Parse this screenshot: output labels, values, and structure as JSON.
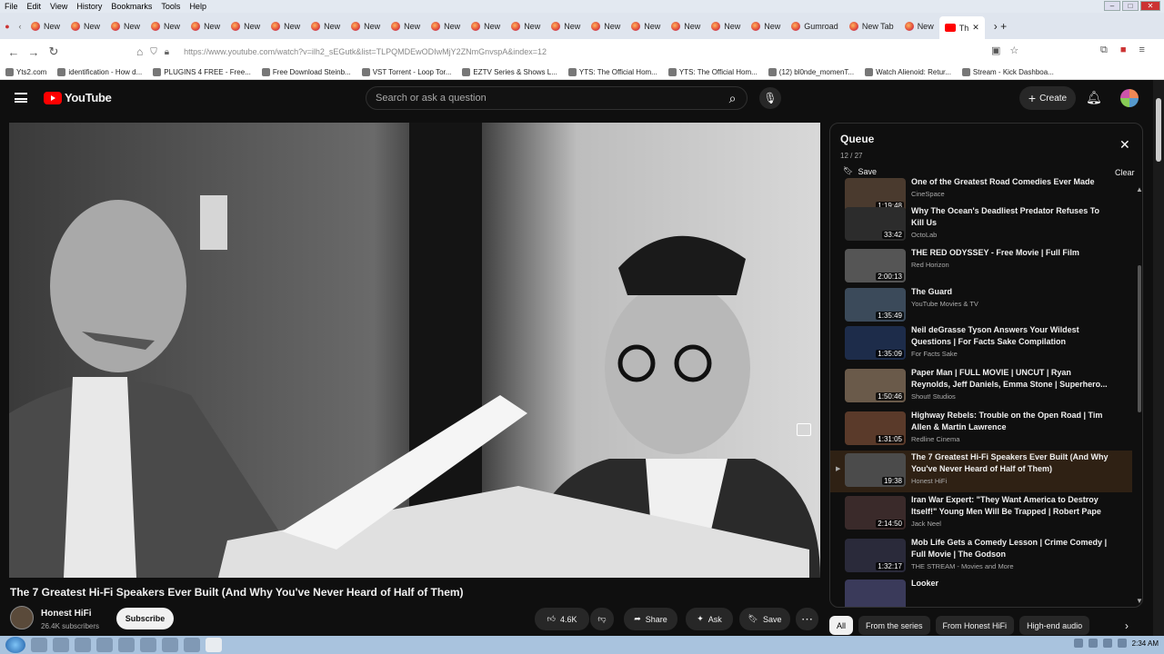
{
  "browser": {
    "menu": [
      "File",
      "Edit",
      "View",
      "History",
      "Bookmarks",
      "Tools",
      "Help"
    ],
    "tabs": [
      "New",
      "New",
      "New",
      "New",
      "New",
      "New",
      "New",
      "New",
      "New",
      "New",
      "New",
      "New",
      "New",
      "New",
      "New",
      "New",
      "New",
      "New",
      "New",
      "Gumroad",
      "New Tab",
      "New"
    ],
    "active_tab_label": "Th",
    "url": "https://www.youtube.com/watch?v=ilh2_sEGutk&list=TLPQMDEwODIwMjY2ZNmGnvspA&index=12",
    "bookmarks": [
      "Yts2.com",
      "identification - How d...",
      "PLUGINS 4 FREE - Free...",
      "Free Download Steinb...",
      "VST Torrent - Loop Tor...",
      "EZTV Series & Shows L...",
      "YTS: The Official Hom...",
      "YTS: The Official Hom...",
      "(12) bl0nde_momenT...",
      "Watch Alienoid: Retur...",
      "Stream - Kick Dashboa..."
    ],
    "colors": {
      "accent": "#ff0000",
      "dark_bg": "#0f0f0f"
    }
  },
  "youtube": {
    "logo_text": "YouTube",
    "search_placeholder": "Search or ask a question",
    "create_label": "Create"
  },
  "video": {
    "title": "The 7 Greatest Hi-Fi Speakers Ever Built (And Why You've Never Heard of Half of Them)",
    "channel": "Honest HiFi",
    "subscribers": "26.4K subscribers",
    "subscribe_label": "Subscribe",
    "likes": "4.6K",
    "share_label": "Share",
    "ask_label": "Ask",
    "save_label": "Save"
  },
  "queue": {
    "title": "Queue",
    "position": "12 / 27",
    "save_label": "Save",
    "clear_label": "Clear",
    "items": [
      {
        "title": "One of the Greatest Road Comedies Ever Made",
        "channel": "CineSpace",
        "duration": "1:19:48",
        "thumb": "#4a3a2e"
      },
      {
        "title": "Why The Ocean's Deadliest Predator Refuses To Kill Us",
        "channel": "OctoLab",
        "duration": "33:42",
        "thumb": "#2c2c2c"
      },
      {
        "title": "THE RED ODYSSEY - Free Movie | Full Film",
        "channel": "Red Horizon",
        "duration": "2:00:13",
        "thumb": "#555555"
      },
      {
        "title": "The Guard",
        "channel": "YouTube Movies & TV",
        "duration": "1:35:49",
        "thumb": "#3b4a5a"
      },
      {
        "title": "Neil deGrasse Tyson Answers Your Wildest Questions | For Facts Sake Compilation",
        "channel": "For Facts Sake",
        "duration": "1:35:09",
        "thumb": "#1d2c4a"
      },
      {
        "title": "Paper Man | FULL MOVIE | UNCUT | Ryan Reynolds, Jeff Daniels, Emma Stone | Superhero...",
        "channel": "Shout! Studios",
        "duration": "1:50:46",
        "thumb": "#6a5a4a"
      },
      {
        "title": "Highway Rebels: Trouble on the Open Road | Tim Allen & Martin Lawrence",
        "channel": "Redline Cinema",
        "duration": "1:31:05",
        "thumb": "#5a3a2a"
      },
      {
        "title": "The 7 Greatest Hi-Fi Speakers Ever Built (And Why You've Never Heard of Half of Them)",
        "channel": "Honest HiFi",
        "duration": "19:38",
        "thumb": "#4b4b4b",
        "selected": true
      },
      {
        "title": "Iran War Expert: \"They Want America to Destroy Itself!\" Young Men Will Be Trapped | Robert Pape",
        "channel": "Jack Neel",
        "duration": "2:14:50",
        "thumb": "#3a2a2a"
      },
      {
        "title": "Mob Life Gets a Comedy Lesson | Crime Comedy | Full Movie | The Godson",
        "channel": "THE STREAM - Movies and More",
        "duration": "1:32:17",
        "thumb": "#2a2a3a"
      },
      {
        "title": "Looker",
        "channel": "",
        "duration": "",
        "thumb": "#3a3a5a"
      }
    ]
  },
  "chips": [
    "All",
    "From the series",
    "From Honest HiFi",
    "High-end audio"
  ],
  "clock": "2:34 AM"
}
